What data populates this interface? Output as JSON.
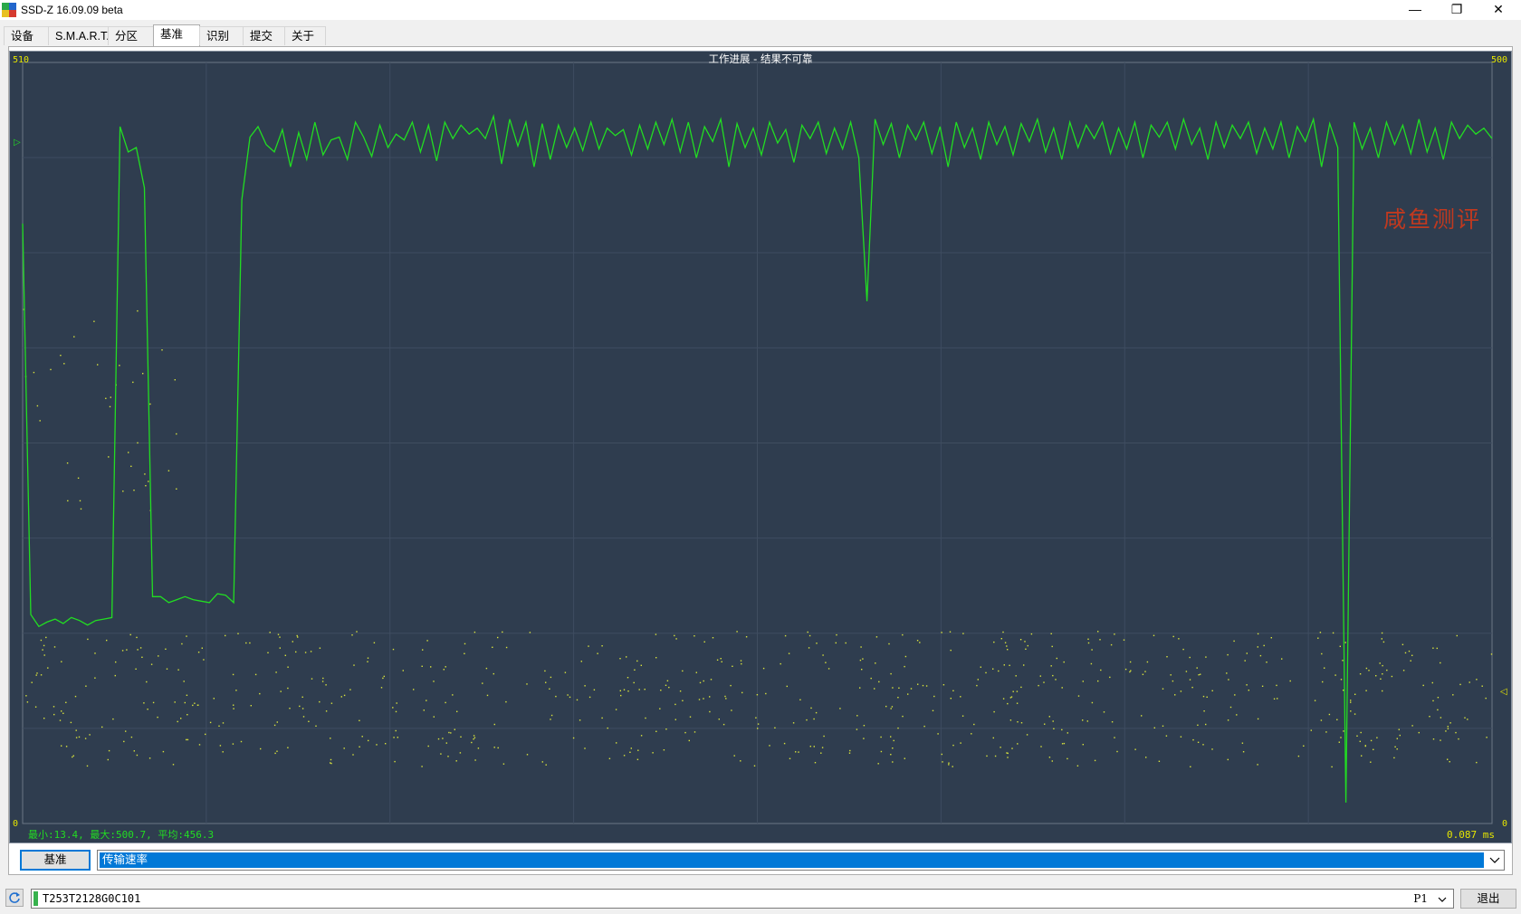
{
  "window": {
    "title": "SSD-Z 16.09.09 beta",
    "minimize": "—",
    "restore": "❐",
    "close": "✕"
  },
  "tabs": [
    {
      "label": "设备"
    },
    {
      "label": "S.M.A.R.T."
    },
    {
      "label": "分区"
    },
    {
      "label": "基准",
      "active": true
    },
    {
      "label": "识别"
    },
    {
      "label": "提交"
    },
    {
      "label": "关于"
    }
  ],
  "graph": {
    "title": "工作进展 - 结果不可靠",
    "left_axis_top": "510",
    "left_axis_bottom": "0",
    "right_axis_top": "500",
    "right_axis_bottom": "0",
    "stats": "最小:13.4, 最大:500.7, 平均:456.3",
    "latency": "0.087 ms",
    "watermark": "咸鱼测评",
    "speed_marker": "▷",
    "latency_marker": "◁",
    "colors": {
      "speed_line": "#22dd22",
      "latency_dots": "#d8e23c",
      "axis_text": "#e6e600",
      "background": "#2f3d4f"
    }
  },
  "chart_data": {
    "type": "line",
    "series": [
      {
        "y_axis": "left",
        "values": [
          402,
          140,
          132,
          135,
          137,
          134,
          138,
          136,
          133,
          136,
          137,
          138,
          467,
          450,
          453,
          426,
          152,
          152,
          148,
          150,
          152,
          150,
          149,
          148,
          154,
          153,
          148,
          418,
          460,
          467,
          455,
          450,
          465,
          440,
          463,
          445,
          470,
          448,
          458,
          460,
          445,
          470,
          460,
          447,
          468,
          453,
          462,
          458,
          470,
          450,
          468,
          444,
          470,
          459,
          468,
          462,
          466,
          459,
          474,
          442,
          472,
          454,
          470,
          440,
          469,
          445,
          468,
          453,
          466,
          451,
          470,
          452,
          466,
          461,
          465,
          448,
          468,
          452,
          470,
          455,
          472,
          450,
          470,
          446,
          467,
          457,
          472,
          440,
          469,
          453,
          466,
          448,
          470,
          456,
          465,
          443,
          468,
          459,
          470,
          449,
          466,
          452,
          470,
          446,
          350,
          472,
          455,
          469,
          446,
          468,
          458,
          470,
          449,
          467,
          440,
          470,
          453,
          466,
          445,
          470,
          455,
          467,
          448,
          469,
          457,
          472,
          450,
          466,
          445,
          470,
          453,
          468,
          459,
          470,
          449,
          466,
          452,
          470,
          446,
          468,
          460,
          470,
          452,
          472,
          455,
          466,
          445,
          470,
          453,
          468,
          459,
          470,
          449,
          466,
          452,
          470,
          446,
          467,
          457,
          472,
          440,
          469,
          453,
          14,
          470,
          452,
          466,
          446,
          470,
          455,
          468,
          449,
          472,
          450,
          466,
          445,
          470,
          459,
          468,
          462,
          466,
          459
        ]
      },
      {
        "y_axis": "right",
        "note": "latency scatter",
        "values": []
      }
    ],
    "left_ylim": [
      0,
      510
    ],
    "right_ylim": [
      0,
      500
    ]
  },
  "bottom": {
    "bench_button": "基准",
    "metric_value": "传输速率"
  },
  "status": {
    "serial": "T253T2128G0C101",
    "partition": "P1",
    "exit_button": "退出"
  }
}
